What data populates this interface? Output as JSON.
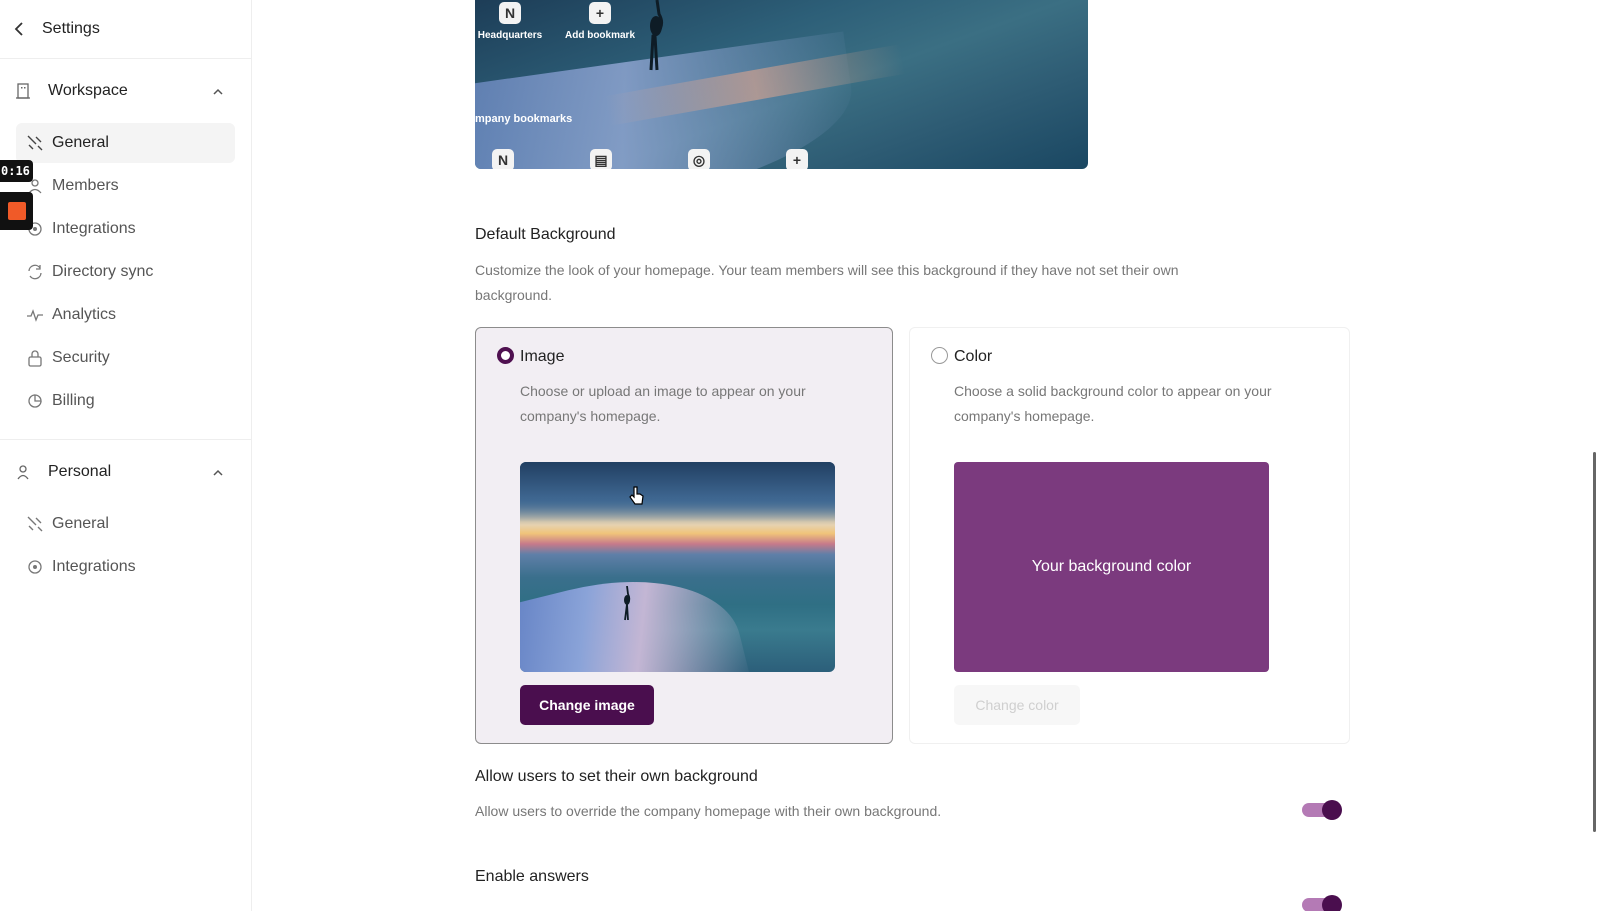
{
  "sidebar": {
    "header": {
      "title": "Settings"
    },
    "workspace": {
      "label": "Workspace",
      "items": [
        {
          "label": "General",
          "icon": "tools-icon",
          "active": true
        },
        {
          "label": "Members",
          "icon": "members-icon"
        },
        {
          "label": "Integrations",
          "icon": "integrations-icon"
        },
        {
          "label": "Directory sync",
          "icon": "sync-icon"
        },
        {
          "label": "Analytics",
          "icon": "analytics-icon"
        },
        {
          "label": "Security",
          "icon": "lock-icon"
        },
        {
          "label": "Billing",
          "icon": "billing-icon"
        }
      ]
    },
    "personal": {
      "label": "Personal",
      "items": [
        {
          "label": "General",
          "icon": "tools-icon"
        },
        {
          "label": "Integrations",
          "icon": "integrations-icon"
        }
      ]
    }
  },
  "recorder": {
    "timer": "0:16"
  },
  "preview": {
    "bookmarks_top": [
      {
        "label": "Headquarters",
        "icon": "notion-icon"
      },
      {
        "label": "Add bookmark",
        "icon": "plus-icon"
      }
    ],
    "company_bookmarks_label": "mpany bookmarks"
  },
  "default_background": {
    "title": "Default Background",
    "description": "Customize the look of your homepage. Your team members will see this background if they have not set their own background.",
    "image_option": {
      "label": "Image",
      "selected": true,
      "description": "Choose or upload an image to appear on your company's homepage.",
      "button": "Change image"
    },
    "color_option": {
      "label": "Color",
      "selected": false,
      "description": "Choose a solid background color to appear on your company's homepage.",
      "swatch_label": "Your background color",
      "swatch_color": "#7b3a7e",
      "button": "Change color"
    }
  },
  "allow_own_background": {
    "title": "Allow users to set their own background",
    "description": "Allow users to override the company homepage with their own background.",
    "enabled": true
  },
  "enable_answers": {
    "title": "Enable answers",
    "enabled": true
  },
  "colors": {
    "brand": "#4a0e4e",
    "toggle_track": "#b47ab5"
  }
}
